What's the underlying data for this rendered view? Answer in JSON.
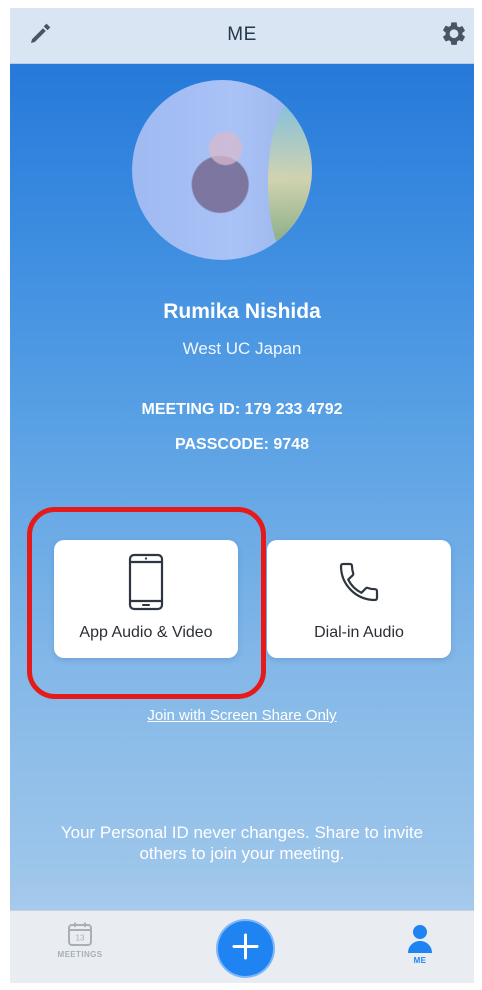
{
  "header": {
    "title": "ME",
    "edit_icon": "pencil-icon",
    "settings_icon": "gear-icon"
  },
  "profile": {
    "name": "Rumika Nishida",
    "organization": "West UC Japan",
    "meeting_id": "MEETING ID: 179 233 4792",
    "passcode": "PASSCODE: 9748"
  },
  "join_options": [
    {
      "label": "App Audio & Video",
      "icon": "phone-icon"
    },
    {
      "label": "Dial-in Audio",
      "icon": "handset-icon"
    }
  ],
  "link": {
    "screen_share": "Join with Screen Share Only"
  },
  "info": {
    "text": "Your Personal ID never changes. Share to invite others to join your meeting."
  },
  "bottom_nav": {
    "meetings_label": "MEETINGS",
    "calendar_day": "13",
    "plus_icon": "plus-icon",
    "me_label": "ME"
  },
  "colors": {
    "accent": "#1f84f1",
    "highlight": "#e51b1b"
  }
}
